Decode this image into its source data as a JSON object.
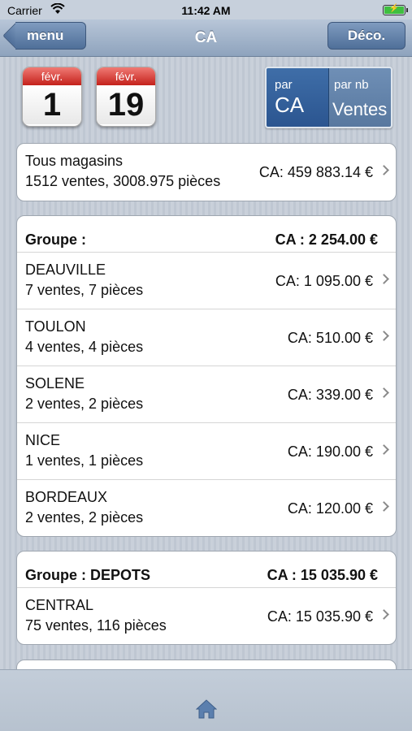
{
  "status_bar": {
    "carrier": "Carrier",
    "time": "11:42 AM"
  },
  "nav": {
    "title": "CA",
    "back_label": "menu",
    "logout_label": "Déco."
  },
  "date_range": {
    "start": {
      "month": "févr.",
      "day": "1"
    },
    "end": {
      "month": "févr.",
      "day": "19"
    }
  },
  "sort_toggle": {
    "by_ca": {
      "small": "par",
      "big": "CA",
      "selected": true
    },
    "by_sales": {
      "small": "par nb",
      "big": "Ventes",
      "selected": false
    }
  },
  "all_stores": {
    "name": "Tous magasins",
    "details": "1512 ventes, 3008.975 pièces",
    "ca": "CA: 459 883.14 €"
  },
  "groups": [
    {
      "label": "Groupe :",
      "ca": "CA : 2 254.00 €",
      "stores": [
        {
          "name": "DEAUVILLE",
          "details": "7 ventes, 7 pièces",
          "ca": "CA: 1 095.00 €"
        },
        {
          "name": "TOULON",
          "details": "4 ventes, 4 pièces",
          "ca": "CA: 510.00 €"
        },
        {
          "name": "SOLENE",
          "details": "2 ventes, 2 pièces",
          "ca": "CA: 339.00 €"
        },
        {
          "name": "NICE",
          "details": "1 ventes, 1 pièces",
          "ca": "CA: 190.00 €"
        },
        {
          "name": "BORDEAUX",
          "details": "2 ventes, 2 pièces",
          "ca": "CA: 120.00 €"
        }
      ]
    },
    {
      "label": "Groupe : DEPOTS",
      "ca": "CA : 15 035.90 €",
      "stores": [
        {
          "name": "CENTRAL",
          "details": "75 ventes, 116 pièces",
          "ca": "CA: 15 035.90 €"
        }
      ]
    }
  ],
  "tab_bar": {
    "icon": "home-icon"
  },
  "colors": {
    "nav_gradient_top": "#b8c6d8",
    "button_blue": "#4f6f99",
    "calendar_red": "#c4211b",
    "segment_selected": "#2b5590"
  }
}
